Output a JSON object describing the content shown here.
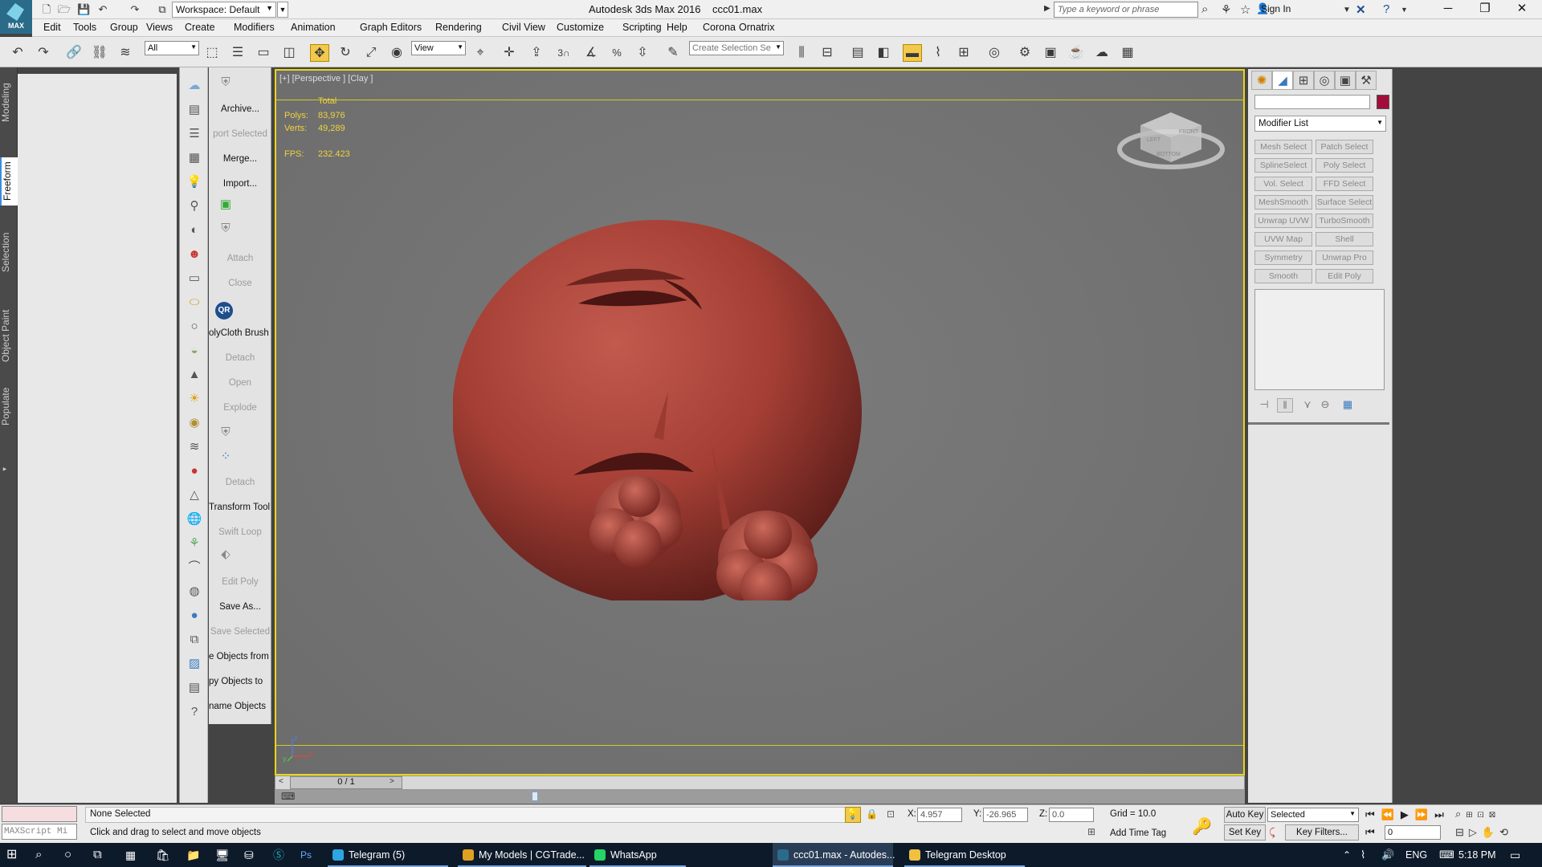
{
  "title_bar": {
    "workspace": "Workspace: Default",
    "app_title": "Autodesk 3ds Max 2016",
    "file_name": "ccc01.max",
    "search_placeholder": "Type a keyword or phrase",
    "sign_in": "Sign In",
    "logo_text": "MAX"
  },
  "menu": [
    "Edit",
    "Tools",
    "Group",
    "Views",
    "Create",
    "Modifiers",
    "Animation",
    "Graph Editors",
    "Rendering",
    "Civil View",
    "Customize",
    "Scripting",
    "Help",
    "Corona",
    "Ornatrix"
  ],
  "toolbar": {
    "filter_select": "All",
    "ref_coord_select": "View",
    "named_selection_placeholder": "Create Selection Se",
    "spinner_label": "3",
    "percent_label": "%"
  },
  "left_tabs": [
    "Modeling",
    "Freeform",
    "Selection",
    "Object Paint",
    "Populate"
  ],
  "script_panel": {
    "labels": [
      {
        "text": "Archive...",
        "disabled": false
      },
      {
        "text": "port Selected",
        "disabled": true
      },
      {
        "text": "Merge...",
        "disabled": false
      },
      {
        "text": "Import...",
        "disabled": false
      },
      {
        "text": "Attach",
        "disabled": true
      },
      {
        "text": "Close",
        "disabled": true
      },
      {
        "text": "olyCloth Brush",
        "disabled": false
      },
      {
        "text": "Detach",
        "disabled": true
      },
      {
        "text": "Open",
        "disabled": true
      },
      {
        "text": "Explode",
        "disabled": true
      },
      {
        "text": "Detach",
        "disabled": true
      },
      {
        "text": "Transform Tool",
        "disabled": false
      },
      {
        "text": "Swift Loop",
        "disabled": true
      },
      {
        "text": "Edit Poly",
        "disabled": true
      },
      {
        "text": "Save As...",
        "disabled": false
      },
      {
        "text": "Save Selected",
        "disabled": true
      },
      {
        "text": "e Objects from",
        "disabled": false
      },
      {
        "text": "py Objects to",
        "disabled": false
      },
      {
        "text": "name Objects",
        "disabled": false
      }
    ],
    "qr_badge": "QR"
  },
  "viewport": {
    "label": "[+] [Perspective ] [Clay ]",
    "stats_header": "Total",
    "polys_label": "Polys:",
    "polys_value": "83,976",
    "verts_label": "Verts:",
    "verts_value": "49,289",
    "fps_label": "FPS:",
    "fps_value": "232.423",
    "viewcube": {
      "left": "LEFT",
      "front": "FRONT",
      "bottom": "BOTTOM"
    },
    "axis": {
      "z": "z",
      "x": "x",
      "y": "y"
    },
    "colors": {
      "model": "#b2443a",
      "frame": "#e8d51a",
      "stats": "#f0d23c"
    }
  },
  "command_panel": {
    "modifier_list": "Modifier List",
    "modifiers": [
      [
        "Mesh Select",
        "Patch Select"
      ],
      [
        "SplineSelect",
        "Poly Select"
      ],
      [
        "Vol. Select",
        "FFD Select"
      ],
      [
        "MeshSmooth",
        "Surface Select"
      ],
      [
        "Unwrap UVW",
        "TurboSmooth"
      ],
      [
        "UVW Map",
        "Shell"
      ],
      [
        "Symmetry",
        "Unwrap Pro"
      ],
      [
        "Smooth",
        "Edit Poly"
      ]
    ],
    "object_color": "#a30d3b"
  },
  "timeline": {
    "frame": "0 / 1"
  },
  "status": {
    "selection": "None Selected",
    "prompt": "Click and drag to select and move objects",
    "x_label": "X:",
    "x_value": "4.957",
    "y_label": "Y:",
    "y_value": "-26.965",
    "z_label": "Z:",
    "z_value": "0.0",
    "grid": "Grid = 10.0",
    "add_time_tag": "Add Time Tag",
    "auto_key": "Auto Key",
    "set_key": "Set Key",
    "key_mode": "Selected",
    "key_filters": "Key Filters...",
    "frame_field": "0",
    "maxscript": "MAXScript Mi"
  },
  "taskbar": {
    "apps": [
      {
        "label": "Telegram (5)",
        "color": "#2ca5e0"
      },
      {
        "label": "My Models | CGTrade...",
        "color": "#e0a020"
      },
      {
        "label": "WhatsApp",
        "color": "#25d366"
      },
      {
        "label": "ccc01.max - Autodes...",
        "color": "#2b6b8a"
      },
      {
        "label": "Telegram Desktop",
        "color": "#f0c040"
      }
    ],
    "language": "ENG",
    "time": "5:18 PM"
  }
}
